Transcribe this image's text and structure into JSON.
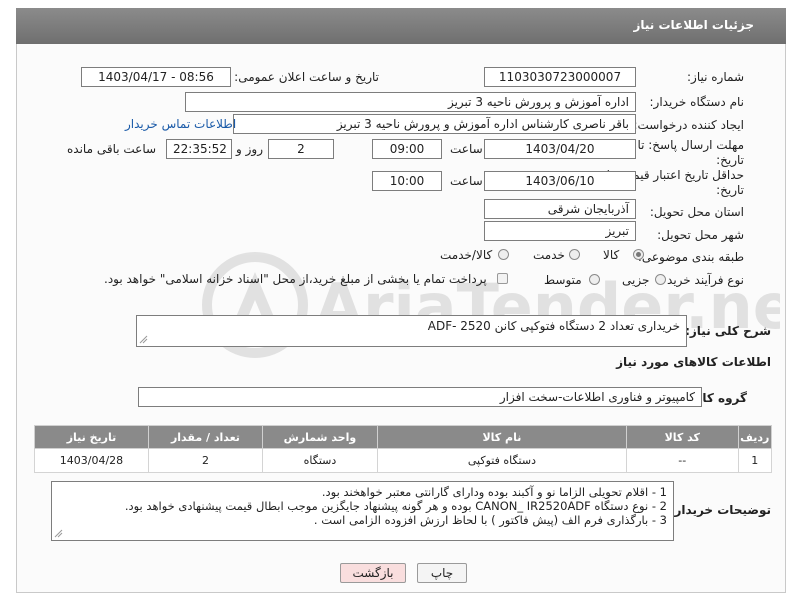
{
  "header": {
    "title": "جزئیات اطلاعات نیاز"
  },
  "form": {
    "need_number": {
      "label": "شماره نیاز:",
      "value": "1103030723000007"
    },
    "announce_datetime": {
      "label": "تاریخ و ساعت اعلان عمومی:",
      "value": "1403/04/17 - 08:56"
    },
    "buyer_org": {
      "label": "نام دستگاه خریدار:",
      "value": "اداره آموزش و پرورش ناحیه 3 تبریز"
    },
    "requester": {
      "label": "ایجاد کننده درخواست:",
      "value": "باقر ناصری کارشناس اداره آموزش و پرورش ناحیه 3 تبریز",
      "contact_link": "اطلاعات تماس خریدار"
    },
    "response_deadline": {
      "label_line1": "مهلت ارسال پاسخ: تا",
      "label_line2": "تاریخ:",
      "date": "1403/04/20",
      "time_label": "ساعت",
      "time": "09:00",
      "days": "2",
      "days_label": "روز و",
      "remaining": "22:35:52",
      "remaining_label": "ساعت باقی مانده"
    },
    "price_validity": {
      "label_line1": "حداقل تاریخ اعتبار قیمت: تا",
      "label_line2": "تاریخ:",
      "date": "1403/06/10",
      "time_label": "ساعت",
      "time": "10:00"
    },
    "province": {
      "label": "استان محل تحویل:",
      "value": "آذربایجان شرقی"
    },
    "city": {
      "label": "شهر محل تحویل:",
      "value": "تبریز"
    },
    "category": {
      "label": "طبقه بندی موضوعی:",
      "options": [
        "کالا",
        "خدمت",
        "کالا/خدمت"
      ],
      "selected": "کالا"
    },
    "purchase_process": {
      "label": "نوع فرآیند خرید :",
      "options": [
        "جزیی",
        "متوسط"
      ],
      "selected": "",
      "payment_note": "پرداخت تمام یا بخشی از مبلغ خرید،از محل \"اسناد خزانه اسلامی\" خواهد بود."
    }
  },
  "summary": {
    "label": "شرح کلی نیاز:",
    "value": "خریداری تعداد 2 دستگاه فتوکپی کانن 2520 -ADF"
  },
  "goods_section": {
    "title": "اطلاعات کالاهای مورد نیاز",
    "group_label": "گروه کالا:",
    "group_value": "کامپیوتر و فناوری اطلاعات-سخت افزار"
  },
  "table": {
    "headers": [
      "ردیف",
      "کد کالا",
      "نام کالا",
      "واحد شمارش",
      "تعداد / مقدار",
      "تاریخ نیاز"
    ],
    "rows": [
      [
        "1",
        "--",
        "دستگاه فتوکپی",
        "دستگاه",
        "2",
        "1403/04/28"
      ]
    ]
  },
  "buyer_notes": {
    "label": "توضیحات خریدار:",
    "lines": [
      "1 - اقلام تحویلی الزاما نو و آکبند بوده ودارای گارانتی معتبر خواهخند بود.",
      "2 - نوع دستگاه CANON_ IR2520ADF  بوده و هر گونه پیشنهاد جایگزین موجب ابطال قیمت پیشنهادی خواهد بود.",
      "3 - بارگذاری فرم الف (پیش فاکتور ) با لحاظ ارزش افزوده الزامی است ."
    ]
  },
  "buttons": {
    "print": "چاپ",
    "back": "بازگشت"
  },
  "watermark": {
    "text": "AriaTender.neT"
  },
  "colors": {
    "header_bg": "#7d7d7d",
    "link": "#1a5aa8",
    "back_button_bg": "#f9dede"
  }
}
